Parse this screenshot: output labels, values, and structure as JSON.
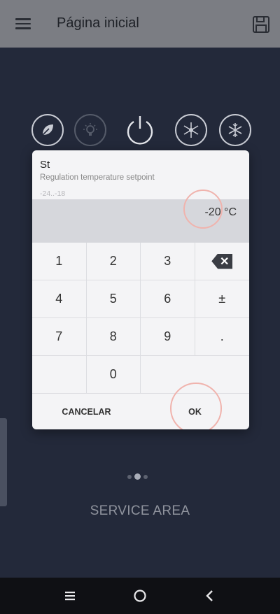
{
  "appbar": {
    "title": "Página inicial",
    "menu_icon": "hamburger-menu-icon",
    "save_icon": "floppy-disk-icon"
  },
  "mode_icons": [
    "leaf-icon",
    "light-bulb-icon",
    "power-icon",
    "defrost-icon",
    "snowflake-icon"
  ],
  "dialog": {
    "title": "St",
    "description": "Regulation temperature setpoint",
    "range": "-24..-18",
    "value": "-20 °C",
    "keys": {
      "k1": "1",
      "k2": "2",
      "k3": "3",
      "k4": "4",
      "k5": "5",
      "k6": "6",
      "sign": "±",
      "k7": "7",
      "k8": "8",
      "k9": "9",
      "dot": ".",
      "k0": "0"
    },
    "cancel_label": "CANCELAR",
    "ok_label": "OK"
  },
  "pager": {
    "pages": 3,
    "active": 2
  },
  "service_area_label": "SERVICE AREA",
  "colors": {
    "background": "#23293a",
    "appbar": "#7b7d83",
    "dialog": "#f4f4f6",
    "value_field": "#d6d7dc",
    "touch_ripple": "#f0b3ad"
  }
}
